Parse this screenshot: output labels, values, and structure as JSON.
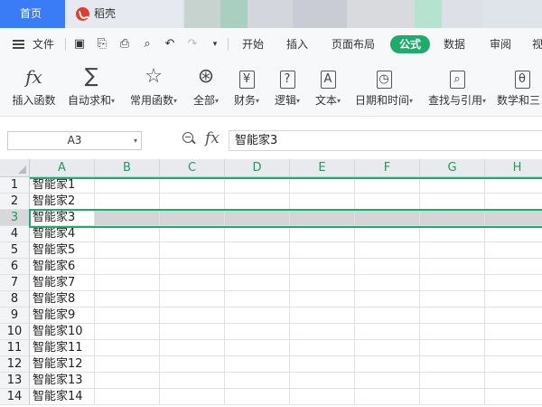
{
  "tabs": {
    "home": "首页",
    "doc": "稻壳"
  },
  "menu": {
    "file_label": "文件",
    "items": [
      "开始",
      "插入",
      "页面布局",
      "公式",
      "数据",
      "审阅",
      "视"
    ],
    "active_item": "公式"
  },
  "ribbon": {
    "buttons": [
      {
        "label": "插入函数",
        "icon": "fx-icon"
      },
      {
        "label": "自动求和",
        "icon": "sigma-icon",
        "dropdown": true
      },
      {
        "label": "常用函数",
        "icon": "star-icon",
        "dropdown": true
      },
      {
        "label": "全部",
        "icon": "asterisk-icon",
        "dropdown": true
      },
      {
        "label": "财务",
        "icon": "yen-icon",
        "dropdown": true
      },
      {
        "label": "逻辑",
        "icon": "question-icon",
        "dropdown": true
      },
      {
        "label": "文本",
        "icon": "text-icon",
        "dropdown": true
      },
      {
        "label": "日期和时间",
        "icon": "clock-icon",
        "dropdown": true
      },
      {
        "label": "查找与引用",
        "icon": "lookup-icon",
        "dropdown": true
      },
      {
        "label": "数学和三",
        "icon": "math-icon"
      }
    ]
  },
  "formula_bar": {
    "name_box": "A3",
    "fx": "fx",
    "content": "智能家3"
  },
  "sheet": {
    "columns": [
      "A",
      "B",
      "C",
      "D",
      "E",
      "F",
      "G",
      "H"
    ],
    "rows": [
      "1",
      "2",
      "3",
      "4",
      "5",
      "6",
      "7",
      "8",
      "9",
      "10",
      "11",
      "12",
      "13",
      "14"
    ],
    "selected_row": "3",
    "col_a_values": [
      "智能家1",
      "智能家2",
      "智能家3",
      "智能家4",
      "智能家5",
      "智能家6",
      "智能家7",
      "智能家8",
      "智能家9",
      "智能家10",
      "智能家11",
      "智能家12",
      "智能家13",
      "智能家14"
    ]
  },
  "colors": {
    "accent_green": "#1eab6c",
    "home_tab_blue": "#3a7bf6"
  }
}
